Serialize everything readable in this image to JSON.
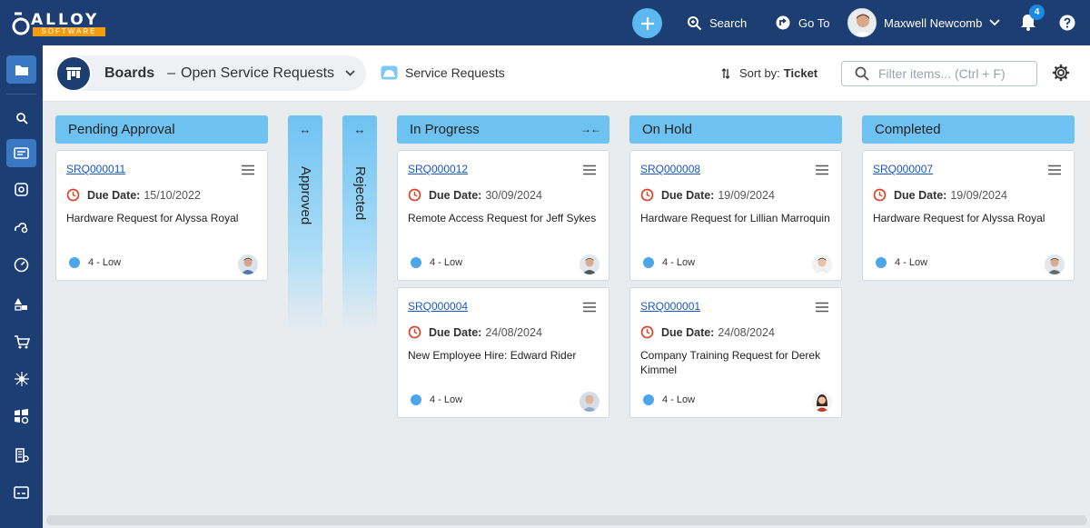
{
  "brand": {
    "name": "ALLOY",
    "sub": "SOFTWARE"
  },
  "topbar": {
    "search_label": "Search",
    "goto_label": "Go To",
    "user_name": "Maxwell Newcomb",
    "notification_count": "4"
  },
  "header": {
    "board_label": "Boards",
    "board_name": "Open Service Requests",
    "dash": "–",
    "service_label": "Service Requests",
    "sort_prefix": "Sort by:",
    "sort_value": "Ticket",
    "filter_placeholder": "Filter items... (Ctrl + F)"
  },
  "columns": {
    "pending": {
      "label": "Pending Approval"
    },
    "approved": {
      "label": "Approved",
      "arrows": "↔"
    },
    "rejected": {
      "label": "Rejected",
      "arrows": "↔"
    },
    "in_progress": {
      "label": "In Progress",
      "collapse": "→←"
    },
    "on_hold": {
      "label": "On Hold"
    },
    "completed": {
      "label": "Completed"
    }
  },
  "due_label": "Due Date:",
  "cards": {
    "c1": {
      "id": "SRQ000011",
      "due": "15/10/2022",
      "title": "Hardware Request for Alyssa Royal",
      "priority": "4 - Low"
    },
    "c2": {
      "id": "SRQ000012",
      "due": "30/09/2024",
      "title": "Remote Access Request for Jeff Sykes",
      "priority": "4 - Low"
    },
    "c3": {
      "id": "SRQ000004",
      "due": "24/08/2024",
      "title": "New Employee Hire: Edward Rider",
      "priority": "4 - Low"
    },
    "c4": {
      "id": "SRQ000008",
      "due": "19/09/2024",
      "title": "Hardware Request for Lillian Marroquin",
      "priority": "4 - Low"
    },
    "c5": {
      "id": "SRQ000001",
      "due": "24/08/2024",
      "title": "Company Training Request for Derek Kimmel",
      "priority": "4 - Low"
    },
    "c6": {
      "id": "SRQ000007",
      "due": "19/09/2024",
      "title": "Hardware Request for Alyssa Royal",
      "priority": "4 - Low"
    }
  },
  "colors": {
    "topbar": "#1d3e73",
    "column_header": "#6ec2f2",
    "accent_plus": "#5cb8f0",
    "due_icon": "#d9462b",
    "priority_dot": "#4ba6ea"
  }
}
